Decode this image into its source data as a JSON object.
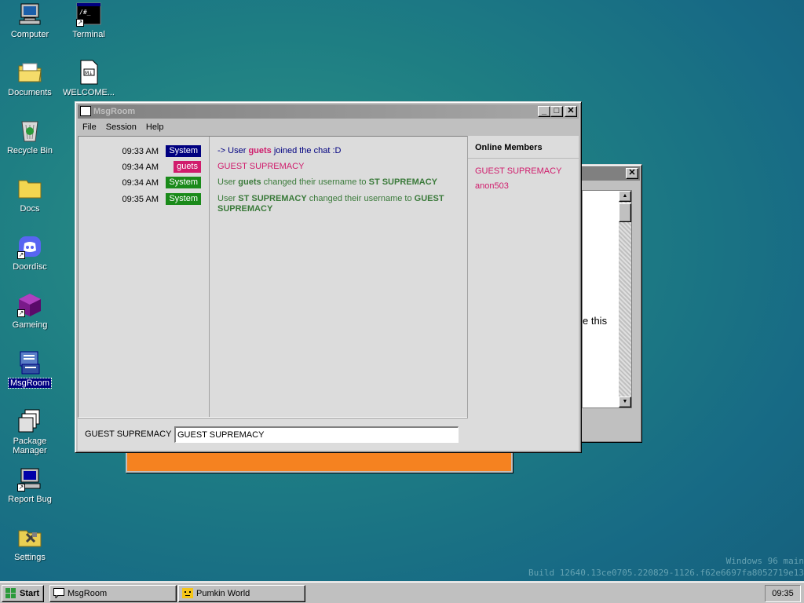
{
  "desktop": {
    "icons": [
      {
        "label": "Computer"
      },
      {
        "label": "Terminal"
      },
      {
        "label": "Documents"
      },
      {
        "label": "WELCOME..."
      },
      {
        "label": "Recycle Bin"
      },
      {
        "label": "Docs"
      },
      {
        "label": "Doordisc"
      },
      {
        "label": "Gameing"
      },
      {
        "label": "MsgRoom"
      },
      {
        "label": "Package Manager"
      },
      {
        "label": "Report Bug"
      },
      {
        "label": "Settings"
      }
    ]
  },
  "back_window": {
    "partial_text": "e this"
  },
  "msgroom": {
    "title": "MsgRoom",
    "menu": [
      "File",
      "Session",
      "Help"
    ],
    "messages": [
      {
        "time": "09:33 AM",
        "badge": "System",
        "badge_color": "#000080",
        "parts": [
          "-> User ",
          "guets",
          " joined the chat :D"
        ],
        "color": "#000080",
        "accent": "#d01c6c"
      },
      {
        "time": "09:34 AM",
        "badge": "guets",
        "badge_color": "#d01c6c",
        "text": "GUEST SUPREMACY",
        "color": "#d01c6c"
      },
      {
        "time": "09:34 AM",
        "badge": "System",
        "badge_color": "#1a8a1a",
        "parts": [
          "User ",
          "guets",
          " changed their username to ",
          "ST SUPREMACY"
        ],
        "color": "#3a7a3a"
      },
      {
        "time": "09:35 AM",
        "badge": "System",
        "badge_color": "#1a8a1a",
        "parts": [
          "User ",
          "ST SUPREMACY",
          " changed their username to ",
          "GUEST SUPREMACY"
        ],
        "color": "#3a7a3a"
      }
    ],
    "members_title": "Online Members",
    "members": [
      "GUEST SUPREMACY",
      "anon503"
    ],
    "input_label": "GUEST SUPREMACY",
    "input_value": "GUEST SUPREMACY"
  },
  "watermark": {
    "line1": "Windows 96 main",
    "line2": "Build 12640.13ce0705.220829-1126.f62e6697fa8052719e13"
  },
  "taskbar": {
    "start_label": "Start",
    "tasks": [
      "MsgRoom",
      "Pumkin World"
    ],
    "clock": "09:35"
  }
}
